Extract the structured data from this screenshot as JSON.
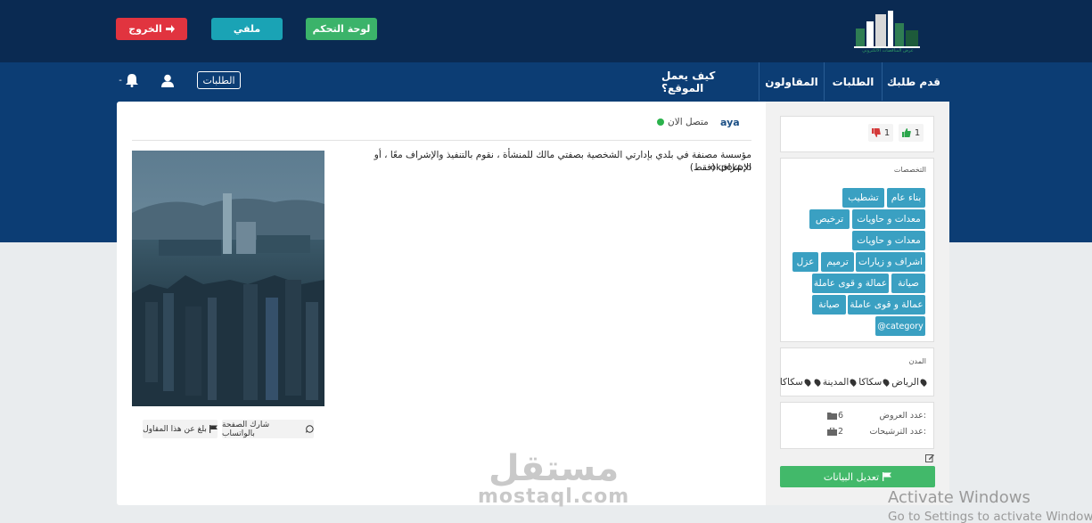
{
  "header": {
    "logo_text": "عرض المناقصات الالكتروني",
    "buttons": {
      "dashboard": "لوحة التحكم",
      "profile": "ملفي",
      "logout": "الخروج"
    }
  },
  "nav": {
    "items": [
      "قدم طلبك",
      "الطلبات",
      "المقاولون",
      "كيف يعمل الموقع؟"
    ],
    "requests_button": "الطلبات",
    "notif_caret": "-"
  },
  "sidebar": {
    "votes": {
      "up": "1",
      "down": "1"
    },
    "specialties_label": "التخصصات",
    "tags": [
      "بناء عام",
      "تشطيب",
      "معدات و حاويات",
      "ترخيص",
      "معدات و حاويات",
      "اشراف و زيارات",
      "ترميم",
      "عزل",
      "صيانة",
      "عمالة و قوى عاملة",
      "عمالة و قوى عاملة",
      "صيانة",
      "@category"
    ],
    "cities_label": "المدن",
    "cities": [
      "الرياض",
      "سكاكا",
      "المدينة",
      "",
      "سكاكا"
    ],
    "offers_label": "عدد العروض:",
    "offers_value": "6",
    "nominations_label": "عدد الترشيحات:",
    "nominations_value": "2",
    "edit_button": "تعديل البيانات"
  },
  "main": {
    "username": "aya",
    "status": "متصل الان",
    "description": "مؤسسة مصنفة في بلدي بإدارتي الشخصية بصفتي مالك للمنشأة ، نقوم بالتنفيذ والإشراف معًا ، أو الإشراف (فقط)",
    "description_extra": "okpokp;o",
    "share_whatsapp": "شارك الصفحة بالواتساب",
    "report": "بلغ عن هذا المقاول"
  },
  "watermark": {
    "arabic": "مستقل",
    "latin": "mostaql.com"
  },
  "os_notice": {
    "title": "Activate Windows",
    "subtitle": "Go to Settings to activate Windows."
  },
  "colors": {
    "topbar": "#0a2a52",
    "navband": "#0c3d74",
    "tag": "#3aa0c2",
    "success": "#42b96a",
    "danger": "#e1343f",
    "info": "#1aa3b5"
  }
}
